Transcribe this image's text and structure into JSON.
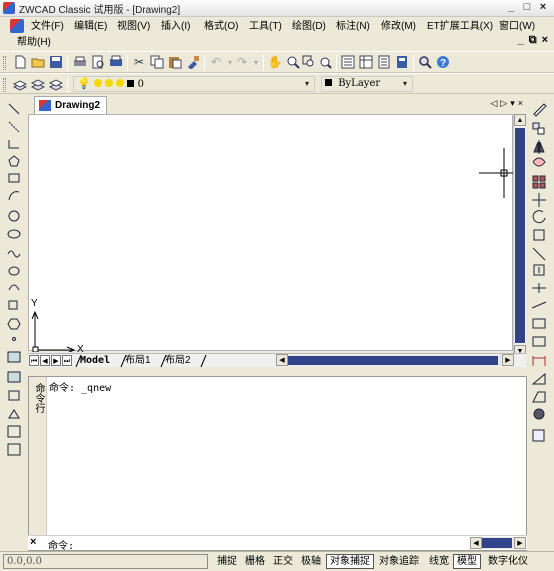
{
  "window": {
    "title": "ZWCAD Classic 试用版 - [Drawing2]",
    "controls": [
      "_",
      "□",
      "×"
    ]
  },
  "menu": {
    "items": [
      "文件(F)",
      "编辑(E)",
      "视图(V)",
      "插入(I)",
      "格式(O)",
      "工具(T)",
      "绘图(D)",
      "标注(N)",
      "修改(M)",
      "ET扩展工具(X)",
      "窗口(W)",
      "帮助(H)"
    ],
    "mdi_controls": [
      "_",
      "⧉",
      "×"
    ]
  },
  "layer_bar": {
    "layer_value": "0",
    "color_value": "ByLayer"
  },
  "document": {
    "tab_label": "Drawing2",
    "nav_glyphs": [
      "◁",
      "▷",
      "▾",
      "×"
    ]
  },
  "ucs": {
    "y_label": "Y",
    "x_label": "X"
  },
  "layout_tabs": [
    "Model",
    "布局1",
    "布局2"
  ],
  "command": {
    "side_label": "命令行",
    "history_line": "命令: _qnew",
    "prompt": "命令:",
    "close_glyph": "×"
  },
  "statusbar": {
    "coords": "0.0,0.0",
    "toggles": [
      {
        "label": "捕捉",
        "on": false
      },
      {
        "label": "栅格",
        "on": false
      },
      {
        "label": "正交",
        "on": false
      },
      {
        "label": "极轴",
        "on": false
      },
      {
        "label": "对象捕捉",
        "on": true
      },
      {
        "label": "对象追踪",
        "on": false
      },
      {
        "label": "线宽",
        "on": false
      },
      {
        "label": "模型",
        "on": true
      },
      {
        "label": "数字化仪",
        "on": false
      }
    ]
  },
  "colors": {
    "accent": "#33438a",
    "chrome": "#ece9d8"
  }
}
